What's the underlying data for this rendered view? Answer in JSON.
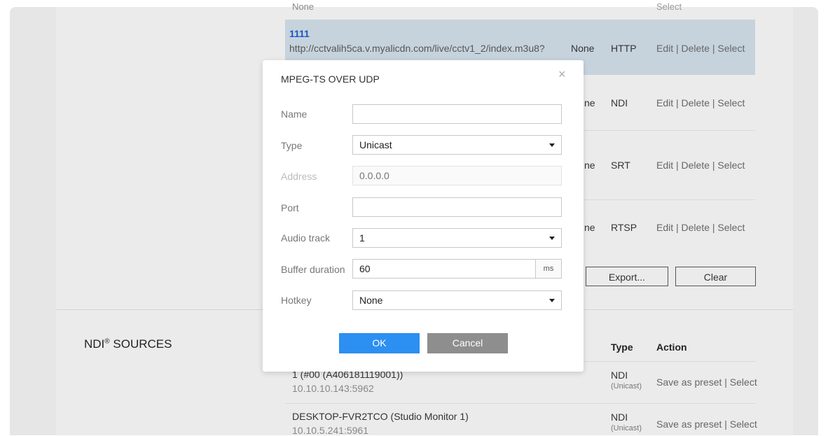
{
  "table": {
    "top_row": {
      "title": "None",
      "action": "Select"
    },
    "rows": [
      {
        "title": "1111",
        "url": "http://cctvalih5ca.v.myalicdn.com/live/cctv1_2/index.m3u8?",
        "hotkey": "None",
        "type": "HTTP",
        "action": "Edit | Delete | Select"
      },
      {
        "hotkey": "ne",
        "type": "NDI",
        "action": "Edit | Delete | Select"
      },
      {
        "hotkey": "ne",
        "type": "SRT",
        "action": "Edit | Delete | Select"
      },
      {
        "hotkey": "ne",
        "type": "RTSP",
        "action": "Edit | Delete | Select"
      }
    ],
    "export_label": "Export...",
    "clear_label": "Clear"
  },
  "ndi": {
    "section_title": "NDI",
    "section_title_mark": "®",
    "section_title_rest": " SOURCES",
    "col_type": "Type",
    "col_action": "Action",
    "sources": [
      {
        "name": "1 (#00 (A406181119001))",
        "address": "10.10.10.143:5962",
        "type": "NDI",
        "mode": "(Unicast)",
        "action": "Save as preset | Select"
      },
      {
        "name": "DESKTOP-FVR2TCO (Studio Monitor 1)",
        "address": "10.10.5.241:5961",
        "type": "NDI",
        "mode": "(Unicast)",
        "action": "Save as preset | Select"
      }
    ]
  },
  "dialog": {
    "title": "MPEG-TS OVER UDP",
    "close": "×",
    "fields": {
      "name_label": "Name",
      "name_value": "",
      "type_label": "Type",
      "type_value": "Unicast",
      "address_label": "Address",
      "address_placeholder": "0.0.0.0",
      "port_label": "Port",
      "port_value": "",
      "audio_label": "Audio track",
      "audio_value": "1",
      "buffer_label": "Buffer duration",
      "buffer_value": "60",
      "buffer_unit": "ms",
      "hotkey_label": "Hotkey",
      "hotkey_value": "None"
    },
    "ok_label": "OK",
    "cancel_label": "Cancel"
  },
  "colors": {
    "primary": "#2c8ff2",
    "link": "#1a56c4",
    "highlight_row": "#c6d3dd",
    "cancel": "#8e8e8e"
  }
}
